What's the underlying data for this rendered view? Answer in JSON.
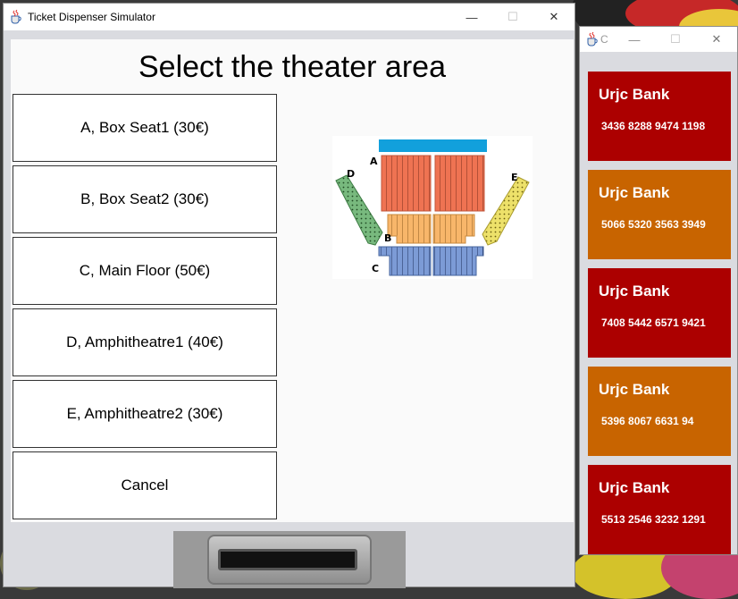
{
  "main_window": {
    "title": "Ticket Dispenser Simulator",
    "controls": {
      "minimize": "—",
      "maximize": "☐",
      "close": "✕"
    }
  },
  "page": {
    "title": "Select the theater area"
  },
  "areas": [
    {
      "label": "A, Box Seat1 (30€)"
    },
    {
      "label": "B, Box Seat2 (30€)"
    },
    {
      "label": "C, Main Floor (50€)"
    },
    {
      "label": "D, Amphitheatre1 (40€)"
    },
    {
      "label": "E, Amphitheatre2 (30€)"
    },
    {
      "label": "Cancel"
    }
  ],
  "seatmap": {
    "labels": {
      "a": "A",
      "b": "B",
      "c": "C",
      "d": "D",
      "e": "E"
    },
    "colors": {
      "stage": "#12a0dc",
      "a": "#ef7352",
      "b": "#f8b66a",
      "c": "#7c9bd6",
      "d": "#78b97e",
      "e": "#ede16a"
    }
  },
  "side_window": {
    "title": "C",
    "controls": {
      "minimize": "—",
      "maximize": "☐",
      "close": "✕"
    }
  },
  "cards": [
    {
      "bank": "Urjc Bank",
      "number": "3436 8288 9474 1198",
      "color": "#ac0000"
    },
    {
      "bank": "Urjc Bank",
      "number": "5066 5320 3563 3949",
      "color": "#c86400"
    },
    {
      "bank": "Urjc Bank",
      "number": "7408 5442 6571 9421",
      "color": "#ac0000"
    },
    {
      "bank": "Urjc Bank",
      "number": "5396 8067 6631 94",
      "color": "#c86400"
    },
    {
      "bank": "Urjc Bank",
      "number": "5513 2546 3232 1291",
      "color": "#ac0000"
    }
  ]
}
